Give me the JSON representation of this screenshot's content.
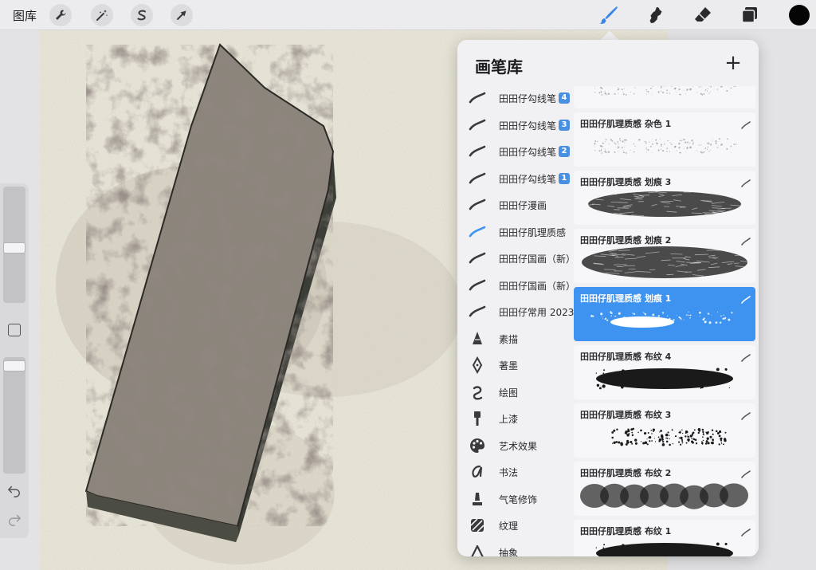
{
  "topbar": {
    "gallery_label": "图库",
    "left_tools": [
      "wrench-icon",
      "magic-wand-icon",
      "selection-s-icon",
      "transform-arrow-icon"
    ],
    "right_tools": [
      "brush-icon",
      "smudge-icon",
      "eraser-icon",
      "layers-icon"
    ],
    "active_tool": "brush-icon",
    "current_color": "#050505"
  },
  "brush_library": {
    "title": "画笔库",
    "add_label": "+",
    "accent_color": "#3f93f0",
    "sets": [
      {
        "label": "田田仔勾线笔",
        "badge": "4",
        "icon": "stroke-icon"
      },
      {
        "label": "田田仔勾线笔",
        "badge": "3",
        "icon": "stroke-icon"
      },
      {
        "label": "田田仔勾线笔",
        "badge": "2",
        "icon": "stroke-icon"
      },
      {
        "label": "田田仔勾线笔",
        "badge": "1",
        "icon": "stroke-icon"
      },
      {
        "label": "田田仔漫画",
        "badge": "",
        "icon": "stroke-icon"
      },
      {
        "label": "田田仔肌理质感",
        "badge": "",
        "icon": "stroke-icon-active"
      },
      {
        "label": "田田仔国画（新）",
        "badge": "",
        "icon": "stroke-icon"
      },
      {
        "label": "田田仔国画（新）",
        "badge": "",
        "icon": "stroke-icon"
      },
      {
        "label": "田田仔常用 2023",
        "badge": "",
        "icon": "stroke-icon"
      },
      {
        "label": "素描",
        "badge": "",
        "icon": "pencil-tip-icon"
      },
      {
        "label": "著墨",
        "badge": "",
        "icon": "pen-nib-icon"
      },
      {
        "label": "绘图",
        "badge": "",
        "icon": "swirl-icon"
      },
      {
        "label": "上漆",
        "badge": "",
        "icon": "paint-brush-icon"
      },
      {
        "label": "艺术效果",
        "badge": "",
        "icon": "palette-icon"
      },
      {
        "label": "书法",
        "badge": "",
        "icon": "calligraphy-icon"
      },
      {
        "label": "气笔修饰",
        "badge": "",
        "icon": "airbrush-icon"
      },
      {
        "label": "纹理",
        "badge": "",
        "icon": "texture-icon"
      },
      {
        "label": "抽象",
        "badge": "",
        "icon": "triangle-icon"
      }
    ],
    "active_set_index": 5,
    "brushes": [
      {
        "name": "",
        "style": "grain"
      },
      {
        "name": "田田仔肌理质感 杂色 1",
        "style": "grain"
      },
      {
        "name": "田田仔肌理质感 划痕 3",
        "style": "blob"
      },
      {
        "name": "田田仔肌理质感 划痕 2",
        "style": "scratch"
      },
      {
        "name": "田田仔肌理质感 划痕 1",
        "style": "light"
      },
      {
        "name": "田田仔肌理质感 布纹 4",
        "style": "solid"
      },
      {
        "name": "田田仔肌理质感 布纹 3",
        "style": "speckle"
      },
      {
        "name": "田田仔肌理质感 布纹 2",
        "style": "cloth"
      },
      {
        "name": "田田仔肌理质感 布纹 1",
        "style": "solid"
      }
    ],
    "selected_brush_index": 4
  },
  "sidebar": {
    "size_slider_value": 0.47,
    "opacity_slider_value": 0.97,
    "undo_icon": "undo-icon",
    "redo_icon": "redo-icon"
  }
}
